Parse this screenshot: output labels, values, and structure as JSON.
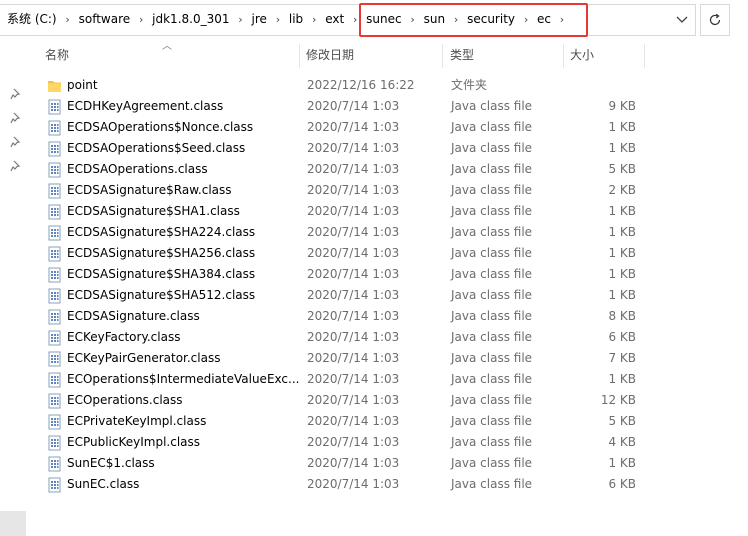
{
  "breadcrumb": [
    "系统 (C:)",
    "software",
    "jdk1.8.0_301",
    "jre",
    "lib",
    "ext",
    "sunec",
    "sun",
    "security",
    "ec"
  ],
  "columns": {
    "name": "名称",
    "date": "修改日期",
    "type": "类型",
    "size": "大小"
  },
  "highlight_color": "#e53935",
  "files": [
    {
      "name": "point",
      "date": "2022/12/16 16:22",
      "type": "文件夹",
      "size": "",
      "icon": "folder-icon"
    },
    {
      "name": "ECDHKeyAgreement.class",
      "date": "2020/7/14 1:03",
      "type": "Java class file",
      "size": "9 KB",
      "icon": "class-file-icon"
    },
    {
      "name": "ECDSAOperations$Nonce.class",
      "date": "2020/7/14 1:03",
      "type": "Java class file",
      "size": "1 KB",
      "icon": "class-file-icon"
    },
    {
      "name": "ECDSAOperations$Seed.class",
      "date": "2020/7/14 1:03",
      "type": "Java class file",
      "size": "1 KB",
      "icon": "class-file-icon"
    },
    {
      "name": "ECDSAOperations.class",
      "date": "2020/7/14 1:03",
      "type": "Java class file",
      "size": "5 KB",
      "icon": "class-file-icon"
    },
    {
      "name": "ECDSASignature$Raw.class",
      "date": "2020/7/14 1:03",
      "type": "Java class file",
      "size": "2 KB",
      "icon": "class-file-icon"
    },
    {
      "name": "ECDSASignature$SHA1.class",
      "date": "2020/7/14 1:03",
      "type": "Java class file",
      "size": "1 KB",
      "icon": "class-file-icon"
    },
    {
      "name": "ECDSASignature$SHA224.class",
      "date": "2020/7/14 1:03",
      "type": "Java class file",
      "size": "1 KB",
      "icon": "class-file-icon"
    },
    {
      "name": "ECDSASignature$SHA256.class",
      "date": "2020/7/14 1:03",
      "type": "Java class file",
      "size": "1 KB",
      "icon": "class-file-icon"
    },
    {
      "name": "ECDSASignature$SHA384.class",
      "date": "2020/7/14 1:03",
      "type": "Java class file",
      "size": "1 KB",
      "icon": "class-file-icon"
    },
    {
      "name": "ECDSASignature$SHA512.class",
      "date": "2020/7/14 1:03",
      "type": "Java class file",
      "size": "1 KB",
      "icon": "class-file-icon"
    },
    {
      "name": "ECDSASignature.class",
      "date": "2020/7/14 1:03",
      "type": "Java class file",
      "size": "8 KB",
      "icon": "class-file-icon"
    },
    {
      "name": "ECKeyFactory.class",
      "date": "2020/7/14 1:03",
      "type": "Java class file",
      "size": "6 KB",
      "icon": "class-file-icon"
    },
    {
      "name": "ECKeyPairGenerator.class",
      "date": "2020/7/14 1:03",
      "type": "Java class file",
      "size": "7 KB",
      "icon": "class-file-icon"
    },
    {
      "name": "ECOperations$IntermediateValueExc...",
      "date": "2020/7/14 1:03",
      "type": "Java class file",
      "size": "1 KB",
      "icon": "class-file-icon"
    },
    {
      "name": "ECOperations.class",
      "date": "2020/7/14 1:03",
      "type": "Java class file",
      "size": "12 KB",
      "icon": "class-file-icon"
    },
    {
      "name": "ECPrivateKeyImpl.class",
      "date": "2020/7/14 1:03",
      "type": "Java class file",
      "size": "5 KB",
      "icon": "class-file-icon"
    },
    {
      "name": "ECPublicKeyImpl.class",
      "date": "2020/7/14 1:03",
      "type": "Java class file",
      "size": "4 KB",
      "icon": "class-file-icon"
    },
    {
      "name": "SunEC$1.class",
      "date": "2020/7/14 1:03",
      "type": "Java class file",
      "size": "1 KB",
      "icon": "class-file-icon"
    },
    {
      "name": "SunEC.class",
      "date": "2020/7/14 1:03",
      "type": "Java class file",
      "size": "6 KB",
      "icon": "class-file-icon"
    }
  ]
}
